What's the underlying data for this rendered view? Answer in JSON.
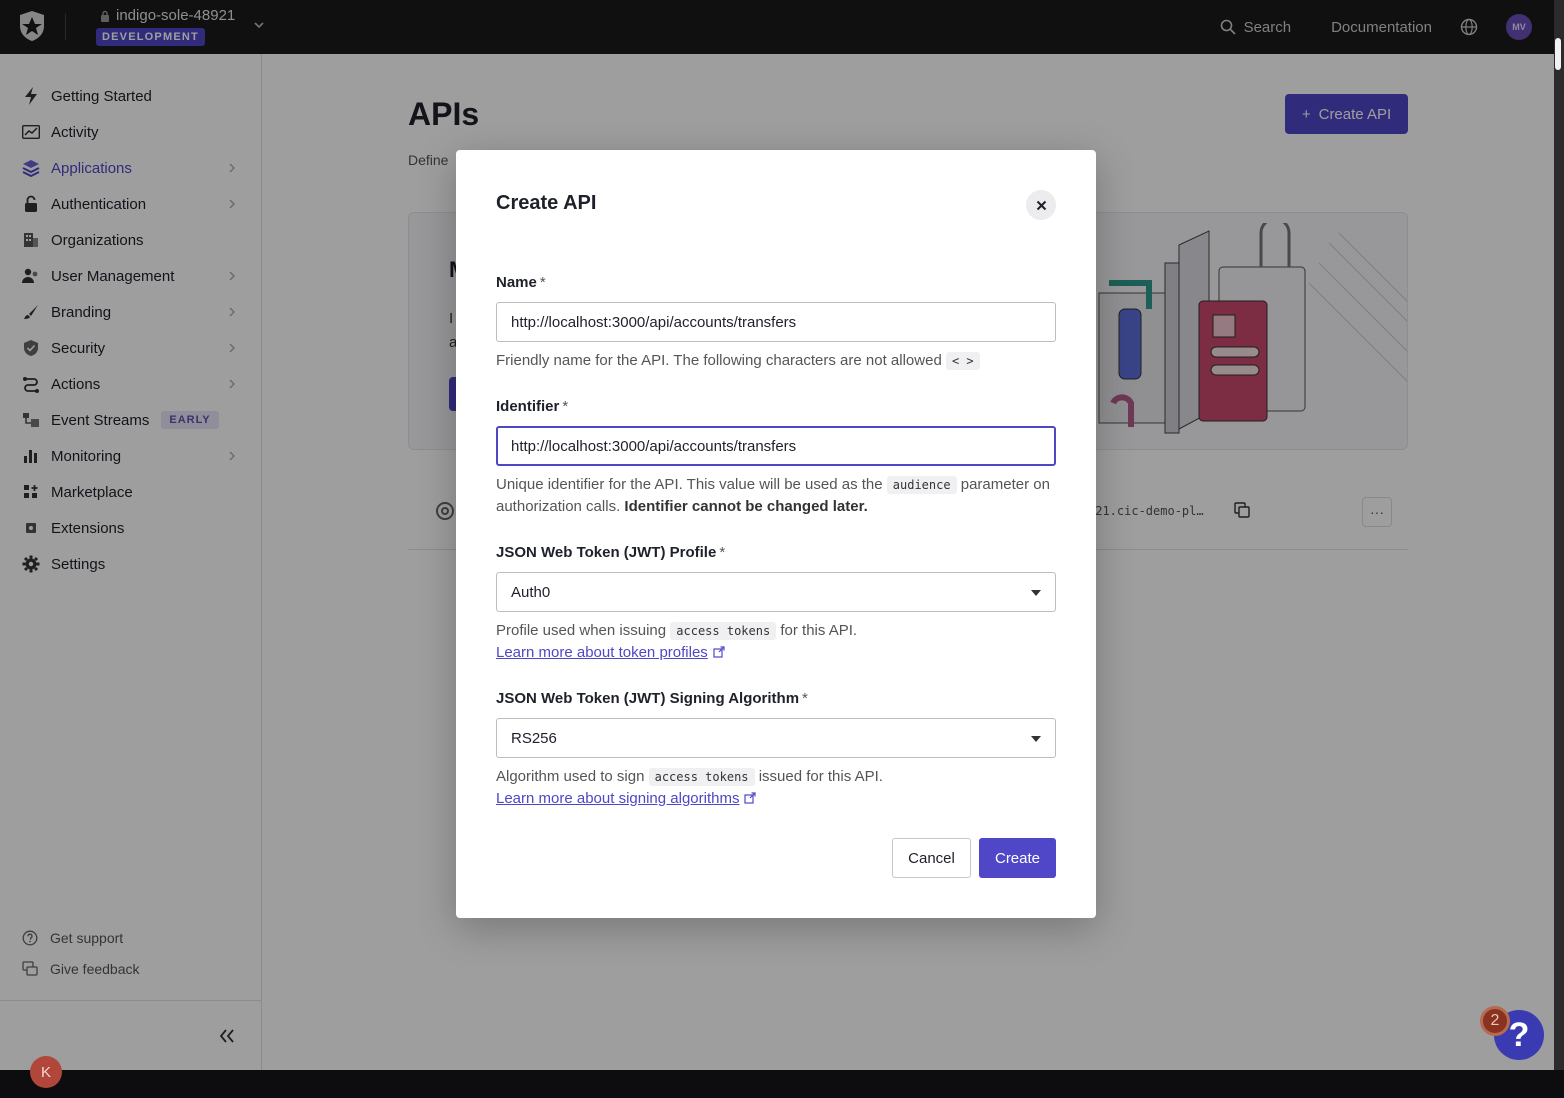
{
  "topbar": {
    "tenant_name": "indigo-sole-48921",
    "environment": "DEVELOPMENT",
    "search_label": "Search",
    "documentation_label": "Documentation",
    "avatar_initials": "MV"
  },
  "sidebar": {
    "items": [
      {
        "label": "Getting Started",
        "icon": "bolt-icon"
      },
      {
        "label": "Activity",
        "icon": "activity-icon"
      },
      {
        "label": "Applications",
        "icon": "layers-icon",
        "active": true
      },
      {
        "label": "Authentication",
        "icon": "lock-icon"
      },
      {
        "label": "Organizations",
        "icon": "building-icon"
      },
      {
        "label": "User Management",
        "icon": "users-icon"
      },
      {
        "label": "Branding",
        "icon": "brush-icon"
      },
      {
        "label": "Security",
        "icon": "shield-icon"
      },
      {
        "label": "Actions",
        "icon": "actions-icon"
      },
      {
        "label": "Event Streams",
        "icon": "streams-icon",
        "badge": "EARLY"
      },
      {
        "label": "Monitoring",
        "icon": "chart-icon"
      },
      {
        "label": "Marketplace",
        "icon": "marketplace-icon"
      },
      {
        "label": "Extensions",
        "icon": "extensions-icon"
      },
      {
        "label": "Settings",
        "icon": "gear-icon"
      }
    ],
    "footer": {
      "support_label": "Get support",
      "feedback_label": "Give feedback"
    }
  },
  "main": {
    "title": "APIs",
    "description": "Define",
    "create_button_label": "Create API",
    "banner_title": "M",
    "banner_line1": "I",
    "banner_line2": "a",
    "api_row_audience": "921.cic-demo-pl…"
  },
  "modal": {
    "title": "Create API",
    "name": {
      "label": "Name",
      "required_mark": "*",
      "value": "http://localhost:3000/api/accounts/transfers",
      "help": "Friendly name for the API. The following characters are not allowed",
      "help_code": "< >"
    },
    "identifier": {
      "label": "Identifier",
      "required_mark": "*",
      "value": "http://localhost:3000/api/accounts/transfers",
      "help_prefix": "Unique identifier for the API. This value will be used as the",
      "help_code": "audience",
      "help_suffix": "parameter on authorization calls.",
      "help_bold": "Identifier cannot be changed later."
    },
    "jwt_profile": {
      "label": "JSON Web Token (JWT) Profile",
      "required_mark": "*",
      "selected": "Auth0",
      "help_prefix": "Profile used when issuing",
      "help_code": "access tokens",
      "help_suffix": "for this API.",
      "link": "Learn more about token profiles"
    },
    "signing_algorithm": {
      "label": "JSON Web Token (JWT) Signing Algorithm",
      "required_mark": "*",
      "selected": "RS256",
      "help_prefix": "Algorithm used to sign",
      "help_code": "access tokens",
      "help_suffix": "issued for this API.",
      "link": "Learn more about signing algorithms"
    },
    "cancel_label": "Cancel",
    "create_label": "Create"
  },
  "help_widget": {
    "symbol": "?",
    "badge_count": "2"
  },
  "taskbar": {
    "avatar_initial": "K"
  },
  "colors": {
    "accent": "#4f46c8",
    "topbar": "#1b1b1c",
    "overlay": "rgba(0,0,0,0.38)"
  }
}
